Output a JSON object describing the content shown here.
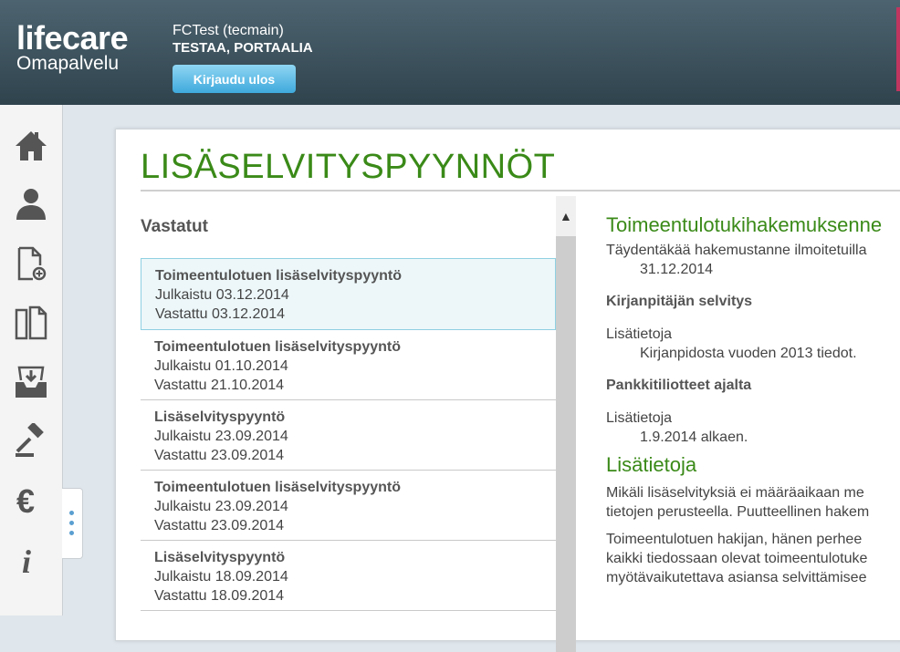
{
  "header": {
    "logo_main": "lifecare",
    "logo_sub": "Omapalvelu",
    "user_name": "FCTest (tecmain)",
    "user_org": "TESTAA, PORTAALIA",
    "logout_label": "Kirjaudu ulos"
  },
  "nav": {
    "icons": [
      "home-icon",
      "person-icon",
      "new-document-icon",
      "documents-icon",
      "inbox-tray-icon",
      "gavel-icon",
      "euro-icon",
      "info-icon"
    ]
  },
  "main": {
    "title": "LISÄSELVITYSPYYNNÖT",
    "list_heading": "Vastatut",
    "requests": [
      {
        "title": "Toimeentulotuen lisäselvityspyyntö",
        "published": "Julkaistu 03.12.2014",
        "answered": "Vastattu 03.12.2014"
      },
      {
        "title": "Toimeentulotuen lisäselvityspyyntö",
        "published": "Julkaistu 01.10.2014",
        "answered": "Vastattu 21.10.2014"
      },
      {
        "title": "Lisäselvityspyyntö",
        "published": "Julkaistu 23.09.2014",
        "answered": "Vastattu 23.09.2014"
      },
      {
        "title": "Toimeentulotuen lisäselvityspyyntö",
        "published": "Julkaistu 23.09.2014",
        "answered": "Vastattu 23.09.2014"
      },
      {
        "title": "Lisäselvityspyyntö",
        "published": "Julkaistu 18.09.2014",
        "answered": "Vastattu 18.09.2014"
      }
    ]
  },
  "detail": {
    "heading": "Toimeentulotukihakemuksenne",
    "intro": "Täydentäkää hakemustanne ilmoitetuilla",
    "intro_date": "31.12.2014",
    "item1_title": "Kirjanpitäjän selvitys",
    "item1_label": "Lisätietoja",
    "item1_value": "Kirjanpidosta vuoden 2013 tiedot.",
    "item2_title": "Pankkitiliotteet ajalta",
    "item2_label": "Lisätietoja",
    "item2_value": "1.9.2014 alkaen.",
    "info_heading": "Lisätietoja",
    "para1_line1": "Mikäli lisäselvityksiä ei määräaikaan me",
    "para1_line2": "tietojen perusteella. Puutteellinen hakem",
    "para2_line1": "Toimeentulotuen hakijan, hänen perhee",
    "para2_line2": "kaikki tiedossaan olevat toimeentulotuke",
    "para2_line3": "myötävaikutettava asiansa selvittämisee"
  },
  "colors": {
    "header_bg": "#3d525d",
    "accent_green": "#3a8a18",
    "button_blue": "#5bbbe6",
    "selected_bg": "#edf7fa"
  }
}
